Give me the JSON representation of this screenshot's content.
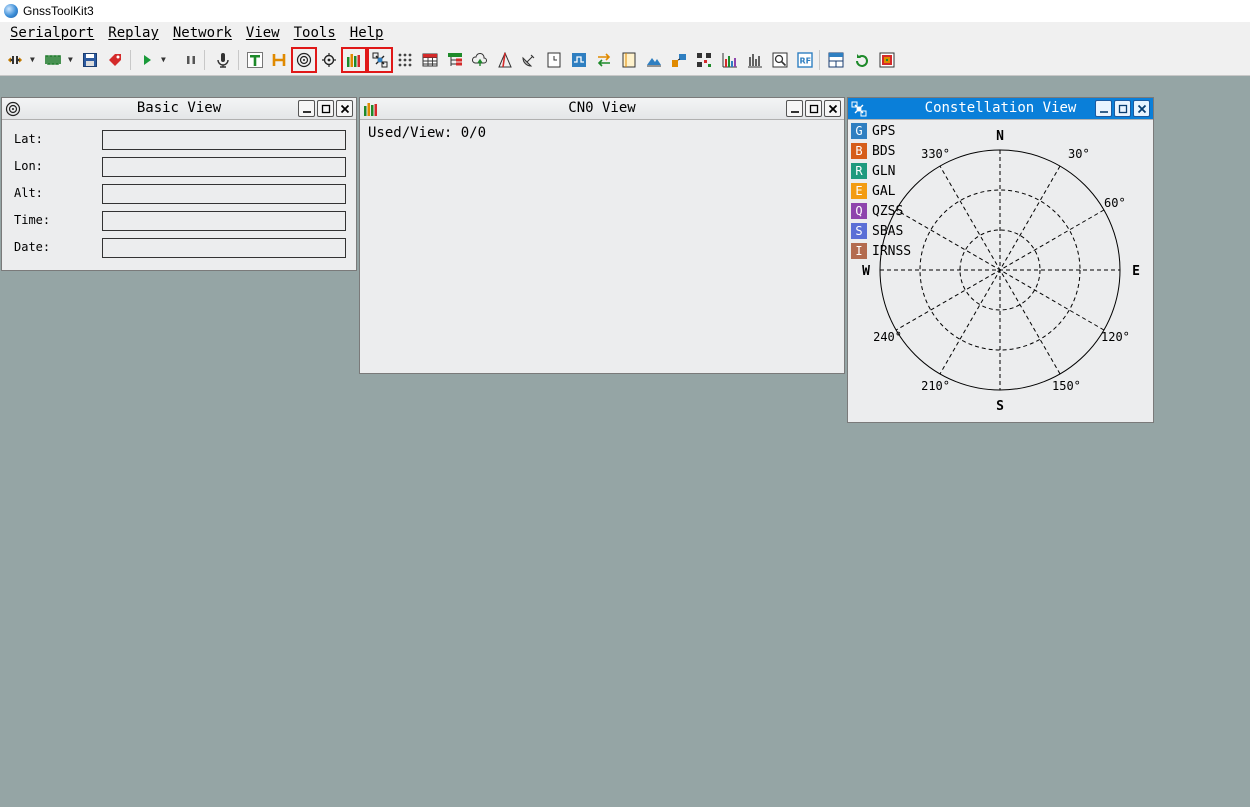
{
  "app": {
    "title": "GnssToolKit3"
  },
  "menu": [
    "Serialport",
    "Replay",
    "Network",
    "View",
    "Tools",
    "Help"
  ],
  "basic_view": {
    "title": "Basic View",
    "fields": [
      {
        "label": "Lat:",
        "value": ""
      },
      {
        "label": "Lon:",
        "value": ""
      },
      {
        "label": "Alt:",
        "value": ""
      },
      {
        "label": "Time:",
        "value": ""
      },
      {
        "label": "Date:",
        "value": ""
      }
    ]
  },
  "cn0_view": {
    "title": "CN0 View",
    "used_view": "Used/View: 0/0"
  },
  "constellation_view": {
    "title": "Constellation View",
    "legend": [
      {
        "code": "G",
        "name": "GPS",
        "color": "#2f7fc1"
      },
      {
        "code": "B",
        "name": "BDS",
        "color": "#d65d1a"
      },
      {
        "code": "R",
        "name": "GLN",
        "color": "#1e9a7e"
      },
      {
        "code": "E",
        "name": "GAL",
        "color": "#f39c12"
      },
      {
        "code": "Q",
        "name": "QZSS",
        "color": "#8e44ad"
      },
      {
        "code": "S",
        "name": "SBAS",
        "color": "#5b6fd6"
      },
      {
        "code": "I",
        "name": "IRNSS",
        "color": "#b36b4f"
      }
    ],
    "compass": {
      "N": "N",
      "E": "E",
      "S": "S",
      "W": "W"
    },
    "angles": [
      "30°",
      "60°",
      "120°",
      "150°",
      "210°",
      "240°",
      "330°"
    ]
  }
}
